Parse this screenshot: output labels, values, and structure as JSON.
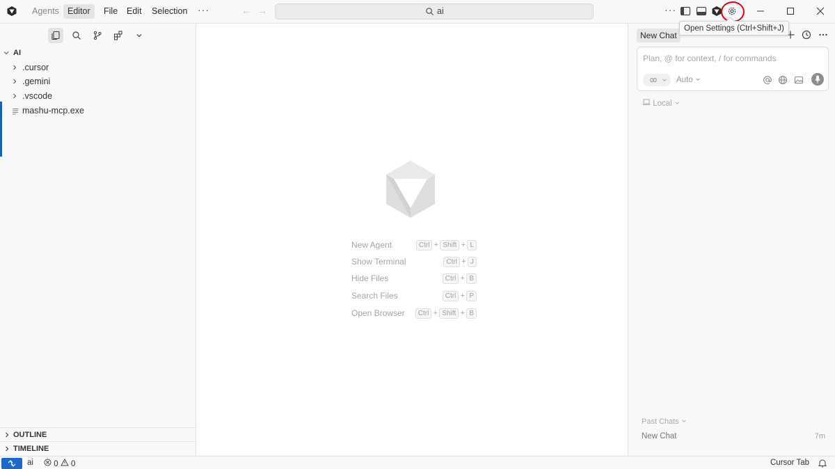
{
  "titlebar": {
    "menus": [
      "Agents",
      "Editor",
      "File",
      "Edit",
      "Selection"
    ],
    "active_menu": "Editor",
    "search_text": "ai",
    "tooltip": "Open Settings (Ctrl+Shift+J)",
    "highlight_color": "#e0001a"
  },
  "sidebar": {
    "root": "AI",
    "items": [
      {
        "label": ".cursor",
        "type": "folder"
      },
      {
        "label": ".gemini",
        "type": "folder"
      },
      {
        "label": ".vscode",
        "type": "folder"
      },
      {
        "label": "mashu-mcp.exe",
        "type": "file"
      }
    ],
    "sections": [
      "OUTLINE",
      "TIMELINE"
    ],
    "accent_color": "#1b5fb0"
  },
  "editor": {
    "shortcuts": [
      {
        "label": "New Agent",
        "keys": [
          "Ctrl",
          "Shift",
          "L"
        ]
      },
      {
        "label": "Show Terminal",
        "keys": [
          "Ctrl",
          "J"
        ]
      },
      {
        "label": "Hide Files",
        "keys": [
          "Ctrl",
          "B"
        ]
      },
      {
        "label": "Search Files",
        "keys": [
          "Ctrl",
          "P"
        ]
      },
      {
        "label": "Open Browser",
        "keys": [
          "Ctrl",
          "Shift",
          "B"
        ]
      }
    ]
  },
  "chat": {
    "tab": "New Chat",
    "placeholder": "Plan, @ for context, / for commands",
    "model": "Auto",
    "location": "Local",
    "past_header": "Past Chats",
    "past_items": [
      {
        "title": "New Chat",
        "time": "7m"
      }
    ]
  },
  "statusbar": {
    "workspace": "ai",
    "errors": "0",
    "warnings": "0",
    "cursor_tab": "Cursor Tab",
    "remote_color": "#1b6ac9"
  }
}
